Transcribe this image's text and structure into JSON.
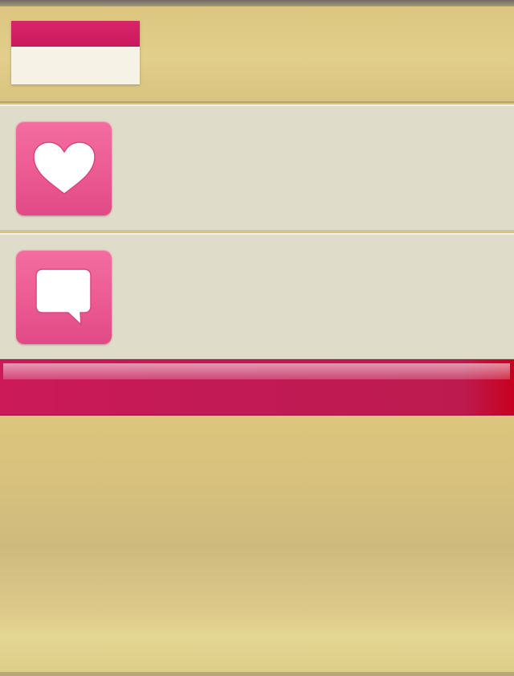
{
  "header": {
    "calendar": {
      "accent_color": "#cc1a5e",
      "body_color": "#f6f3e6"
    }
  },
  "list": {
    "items": [
      {
        "icon": "heart-icon",
        "tile_color": "#ec5a92"
      },
      {
        "icon": "speech-bubble-icon",
        "tile_color": "#ec5a92"
      }
    ]
  },
  "banner": {
    "color": "#c21a55"
  },
  "theme": {
    "background": "#d7c37f",
    "row_background": "#dfdcc9"
  }
}
